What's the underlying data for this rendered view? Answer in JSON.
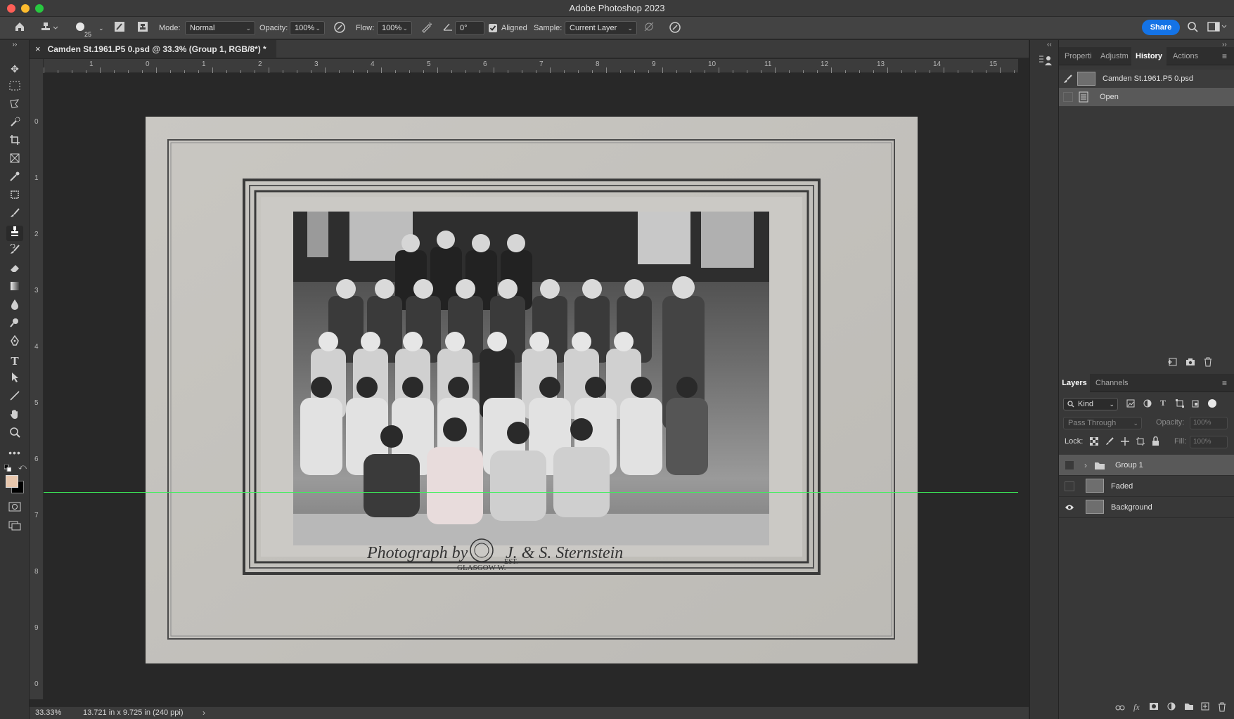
{
  "window": {
    "title": "Adobe Photoshop 2023"
  },
  "options": {
    "brush_size": "25",
    "mode_label": "Mode:",
    "mode_value": "Normal",
    "opacity_label": "Opacity:",
    "opacity_value": "100%",
    "flow_label": "Flow:",
    "flow_value": "100%",
    "angle_value": "0°",
    "aligned_label": "Aligned",
    "aligned_checked": true,
    "sample_label": "Sample:",
    "sample_value": "Current Layer",
    "share_label": "Share"
  },
  "document": {
    "tab_title": "Camden St.1961.P5 0.psd @ 33.3% (Group 1, RGB/8*) *",
    "close_glyph": "×"
  },
  "ruler": {
    "h_labels": [
      "1",
      "0",
      "1",
      "2",
      "3",
      "4",
      "5",
      "6",
      "7",
      "8",
      "9",
      "10",
      "11",
      "12",
      "13",
      "14",
      "15"
    ],
    "v_labels": [
      "0",
      "1",
      "2",
      "3",
      "4",
      "5",
      "6",
      "7",
      "8",
      "9",
      "0"
    ]
  },
  "photo": {
    "caption_left": "Photograph by",
    "caption_right": "J. & S. Sternstein",
    "stamp_text": "EST.",
    "stamp_sub": "GLASGOW W."
  },
  "status": {
    "zoom": "33.33%",
    "doc_info": "13.721 in x 9.725 in (240 ppi)",
    "arrow": "›"
  },
  "history_panel": {
    "tabs": [
      "Properti",
      "Adjustm",
      "History",
      "Actions"
    ],
    "active_tab": "History",
    "snapshot_name": "Camden St.1961.P5 0.psd",
    "states": [
      "Open"
    ]
  },
  "layers_panel": {
    "tabs": [
      "Layers",
      "Channels"
    ],
    "active_tab": "Layers",
    "filter_kind": "Kind",
    "blend_mode": "Pass Through",
    "opacity_label": "Opacity:",
    "opacity_value": "100%",
    "lock_label": "Lock:",
    "fill_label": "Fill:",
    "fill_value": "100%",
    "layers": [
      {
        "name": "Group 1",
        "visible": false,
        "is_group": true,
        "selected": true
      },
      {
        "name": "Faded",
        "visible": false,
        "is_group": false,
        "selected": false
      },
      {
        "name": "Background",
        "visible": true,
        "is_group": false,
        "selected": false
      }
    ]
  },
  "colors": {
    "accent": "#1473e6",
    "guide": "#3cf05a",
    "foreground": "#e8c7ad",
    "background": "#000000"
  }
}
